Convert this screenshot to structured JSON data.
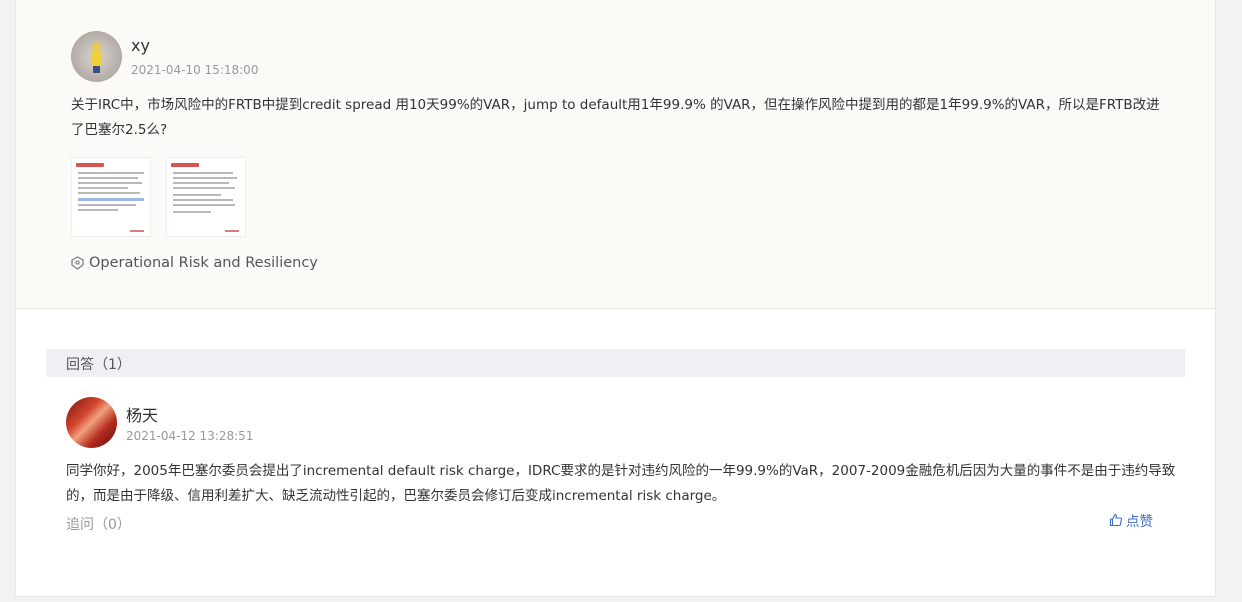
{
  "question": {
    "user": "xy",
    "time": "2021-04-10 15:18:00",
    "text": "关于IRC中，市场风险中的FRTB中提到credit spread 用10天99%的VAR，jump to default用1年99.9% 的VAR，但在操作风险中提到用的都是1年99.9%的VAR，所以是FRTB改进了巴塞尔2.5么?",
    "tag": "Operational Risk and Resiliency"
  },
  "answers": {
    "header": "回答（1）",
    "items": [
      {
        "user": "杨天",
        "time": "2021-04-12 13:28:51",
        "text": "同学你好，2005年巴塞尔委员会提出了incremental default risk charge，IDRC要求的是针对违约风险的一年99.9%的VaR，2007-2009金融危机后因为大量的事件不是由于违约导致的，而是由于降级、信用利差扩大、缺乏流动性引起的，巴塞尔委员会修订后变成incremental risk charge。",
        "followup": "追问（0）",
        "like": "点赞"
      }
    ]
  },
  "colors": {
    "page_bg": "#f2f2f2",
    "question_bg": "#fbfaf6",
    "answers_bar_bg": "#eef0f3",
    "link": "#3b6ec7",
    "muted": "#999999"
  },
  "icons": {
    "tag": "tag-icon",
    "like": "thumbs-up-icon"
  }
}
